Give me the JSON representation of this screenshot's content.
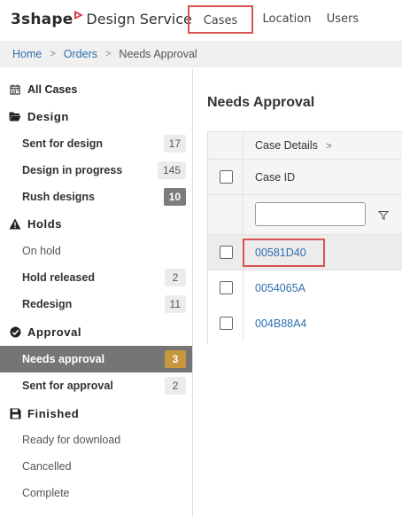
{
  "header": {
    "brand": "3shape",
    "product": "Design Service",
    "nav": [
      {
        "label": "Cases"
      },
      {
        "label": "Location"
      },
      {
        "label": "Users"
      }
    ]
  },
  "breadcrumb": {
    "items": [
      "Home",
      "Orders"
    ],
    "current": "Needs Approval",
    "separator": ">"
  },
  "sidebar": {
    "all_cases": "All Cases",
    "sections": {
      "design": "Design",
      "holds": "Holds",
      "approval": "Approval",
      "finished": "Finished"
    },
    "items": {
      "sent_for_design": {
        "label": "Sent for design",
        "count": "17"
      },
      "design_in_progress": {
        "label": "Design in progress",
        "count": "145"
      },
      "rush_designs": {
        "label": "Rush designs",
        "count": "10"
      },
      "on_hold": {
        "label": "On hold"
      },
      "hold_released": {
        "label": "Hold released",
        "count": "2"
      },
      "redesign": {
        "label": "Redesign",
        "count": "11"
      },
      "needs_approval": {
        "label": "Needs approval",
        "count": "3"
      },
      "sent_for_approval": {
        "label": "Sent for approval",
        "count": "2"
      },
      "ready_for_download": {
        "label": "Ready for download"
      },
      "cancelled": {
        "label": "Cancelled"
      },
      "complete": {
        "label": "Complete"
      }
    }
  },
  "main": {
    "title": "Needs Approval",
    "grid": {
      "group_header": "Case Details",
      "group_chevron": ">",
      "column_case_id": "Case ID",
      "filter_value": "",
      "rows": [
        {
          "case_id": "00581D40"
        },
        {
          "case_id": "0054065A"
        },
        {
          "case_id": "004B88A4"
        }
      ]
    }
  },
  "colors": {
    "accent_link": "#2f6fb0",
    "highlight_red": "#d9534f",
    "active_row": "#757575",
    "approval_badge": "#c8963e",
    "brand_mark": "#d9364f"
  }
}
